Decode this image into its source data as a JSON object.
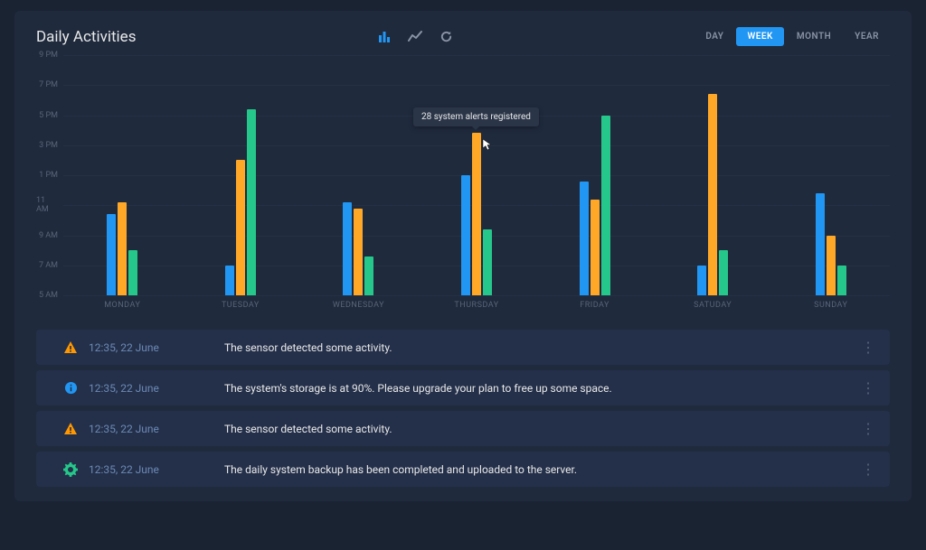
{
  "header": {
    "title": "Daily Activities"
  },
  "time_filters": {
    "options": [
      "DAY",
      "WEEK",
      "MONTH",
      "YEAR"
    ],
    "active": "WEEK"
  },
  "tooltip": {
    "text": "28 system alerts registered"
  },
  "chart_data": {
    "type": "bar",
    "categories": [
      "MONDAY",
      "TUESDAY",
      "WEDNESDAY",
      "THURSDAY",
      "FRIDAY",
      "SATUDAY",
      "SUNDAY"
    ],
    "y_ticks": [
      "5 AM",
      "7 AM",
      "9 AM",
      "11 AM",
      "1 PM",
      "3 PM",
      "5 PM",
      "7 PM",
      "9 PM"
    ],
    "y_index_range": [
      0,
      8
    ],
    "series": [
      {
        "name": "blue",
        "color": "#2196f3",
        "values": [
          2.7,
          1.0,
          3.1,
          4.0,
          3.8,
          1.0,
          3.4
        ]
      },
      {
        "name": "orange",
        "color": "#ffa726",
        "values": [
          3.1,
          4.5,
          2.9,
          5.4,
          3.2,
          6.7,
          2.0
        ]
      },
      {
        "name": "green",
        "color": "#26c78a",
        "values": [
          1.5,
          6.2,
          1.3,
          2.2,
          6.0,
          1.5,
          1.0
        ]
      }
    ],
    "xlabel": "",
    "ylabel": ""
  },
  "activities": [
    {
      "icon": "warning",
      "time": "12:35, 22 June",
      "message": "The sensor detected some activity."
    },
    {
      "icon": "info",
      "time": "12:35, 22 June",
      "message": "The system's storage is at 90%. Please upgrade your plan to free up some space."
    },
    {
      "icon": "warning",
      "time": "12:35, 22 June",
      "message": "The sensor detected some activity."
    },
    {
      "icon": "gear",
      "time": "12:35, 22 June",
      "message": "The daily system backup has been completed and uploaded to the server."
    }
  ]
}
